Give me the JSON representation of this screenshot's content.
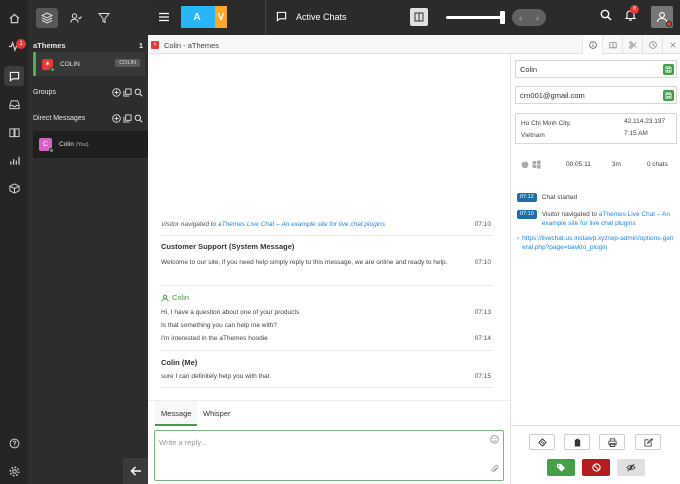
{
  "rail": {
    "pulse_badge": "1"
  },
  "sidebar": {
    "workspace": "aThemes",
    "workspace_count": "1",
    "active_chat": {
      "name": "COLIN",
      "tag": "COLIN",
      "avatar": "✶"
    },
    "groups_label": "Groups",
    "dm_label": "Direct Messages",
    "dm_item": {
      "name": "Colin",
      "suffix": "(You)",
      "avatar": "C"
    }
  },
  "topbar": {
    "logo_left": "A",
    "logo_right": "V",
    "section_title": "Active Chats",
    "notification_count": "8"
  },
  "chat_tab": {
    "title": "Colin - aThemes",
    "close_symbol": "×"
  },
  "messages": {
    "navigation": {
      "prefix": "Visitor navigated to",
      "link": "aThemes Live Chat – An example site for live chat plugins",
      "time": "07:10"
    },
    "blocks": [
      {
        "sender": "Customer Support (System Message)",
        "lines": [
          {
            "text": "Welcome to our site, if you need help simply reply to this message, we are online and ready to help.",
            "time": "07:10"
          }
        ]
      },
      {
        "sender": "Colin",
        "lines": [
          {
            "text": "Hi, I have a question about one of your products",
            "time": "07:13"
          },
          {
            "text": "Is that something you can help me with?",
            "time": ""
          },
          {
            "text": "I'm interested in the aThemes hoodie",
            "time": "07:14"
          }
        ]
      },
      {
        "sender": "Colin (Me)",
        "lines": [
          {
            "text": "sure I can definitely help you with that",
            "time": "07:15"
          }
        ]
      }
    ]
  },
  "compose": {
    "tabs": [
      "Message",
      "Whisper"
    ],
    "placeholder": "Write a reply..."
  },
  "visitor": {
    "name": "Colin",
    "email": "crn001@gmail.com",
    "city": "Ho Chi Minh City, Vietnam",
    "ip": "42.114.23.197",
    "local_time": "7:15 AM",
    "duration": "00:05:11",
    "idle": "3m",
    "chats": "0 chats"
  },
  "events": [
    {
      "time": "07:12",
      "text": "Chat started",
      "link": ""
    },
    {
      "time": "07:10",
      "text": "Visitor navigated to",
      "link": "aThemes Live Chat – An example site for live chat plugins"
    }
  ],
  "referrer_url": "https://livechat.us.instawp.xyz/wp-admin/options-general.php?page=tawkto_plugin",
  "colors": {
    "accent_green": "#43a047",
    "danger_red": "#b71c1c",
    "logo_blue": "#29b6f6",
    "logo_orange": "#ffa726",
    "event_blue": "#1e6fa8"
  }
}
